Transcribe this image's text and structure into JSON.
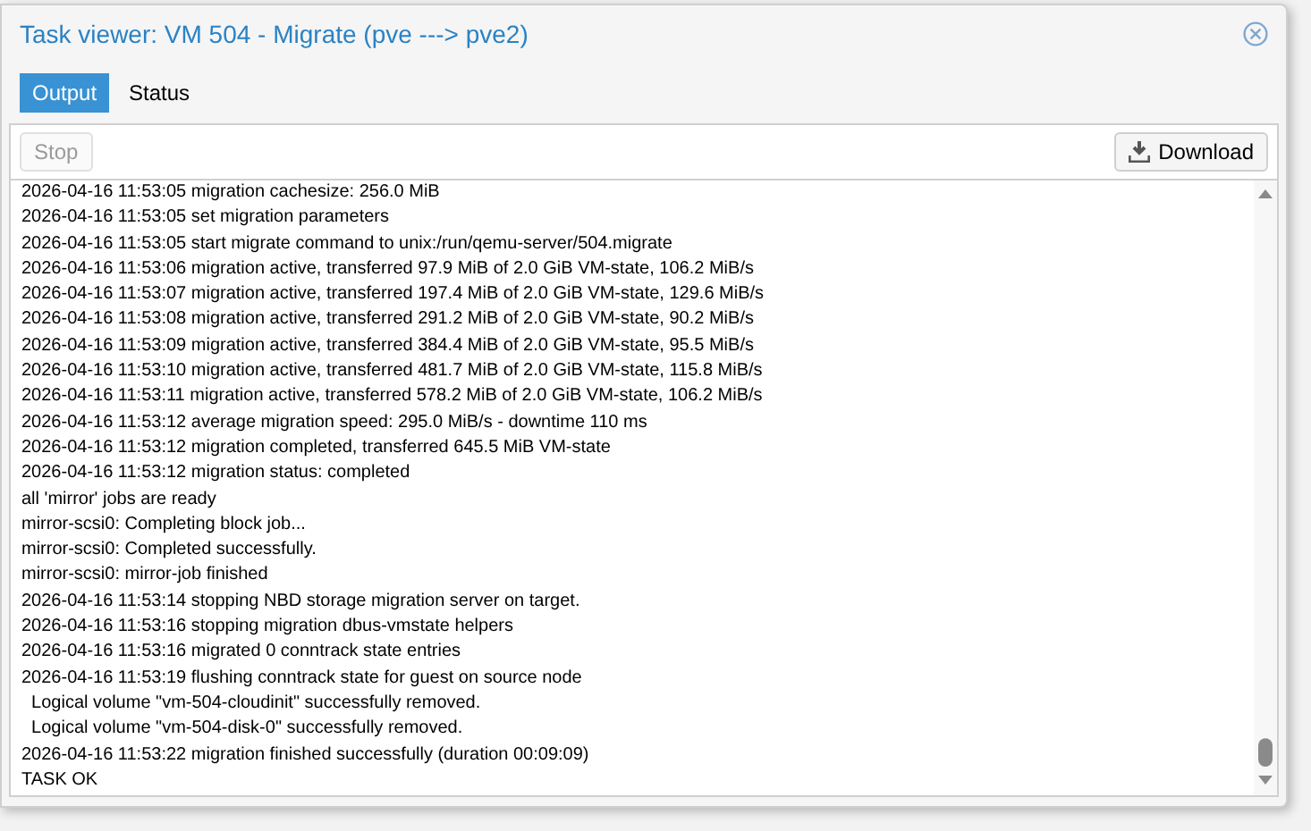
{
  "window": {
    "title": "Task viewer: VM 504 - Migrate (pve ---> pve2)"
  },
  "tabs": [
    {
      "label": "Output",
      "selected": true
    },
    {
      "label": "Status",
      "selected": false
    }
  ],
  "toolbar": {
    "stop_button": {
      "label": "Stop",
      "disabled": true
    },
    "download_button": {
      "label": "Download"
    }
  },
  "log_lines": [
    "2026-04-16 11:53:05 migration cachesize: 256.0 MiB",
    "2026-04-16 11:53:05 set migration parameters",
    "2026-04-16 11:53:05 start migrate command to unix:/run/qemu-server/504.migrate",
    "2026-04-16 11:53:06 migration active, transferred 97.9 MiB of 2.0 GiB VM-state, 106.2 MiB/s",
    "2026-04-16 11:53:07 migration active, transferred 197.4 MiB of 2.0 GiB VM-state, 129.6 MiB/s",
    "2026-04-16 11:53:08 migration active, transferred 291.2 MiB of 2.0 GiB VM-state, 90.2 MiB/s",
    "2026-04-16 11:53:09 migration active, transferred 384.4 MiB of 2.0 GiB VM-state, 95.5 MiB/s",
    "2026-04-16 11:53:10 migration active, transferred 481.7 MiB of 2.0 GiB VM-state, 115.8 MiB/s",
    "2026-04-16 11:53:11 migration active, transferred 578.2 MiB of 2.0 GiB VM-state, 106.2 MiB/s",
    "2026-04-16 11:53:12 average migration speed: 295.0 MiB/s - downtime 110 ms",
    "2026-04-16 11:53:12 migration completed, transferred 645.5 MiB VM-state",
    "2026-04-16 11:53:12 migration status: completed",
    "all 'mirror' jobs are ready",
    "mirror-scsi0: Completing block job...",
    "mirror-scsi0: Completed successfully.",
    "mirror-scsi0: mirror-job finished",
    "2026-04-16 11:53:14 stopping NBD storage migration server on target.",
    "2026-04-16 11:53:16 stopping migration dbus-vmstate helpers",
    "2026-04-16 11:53:16 migrated 0 conntrack state entries",
    "2026-04-16 11:53:19 flushing conntrack state for guest on source node",
    "  Logical volume \"vm-504-cloudinit\" successfully removed.",
    "  Logical volume \"vm-504-disk-0\" successfully removed.",
    "2026-04-16 11:53:22 migration finished successfully (duration 00:09:09)",
    "TASK OK"
  ]
}
